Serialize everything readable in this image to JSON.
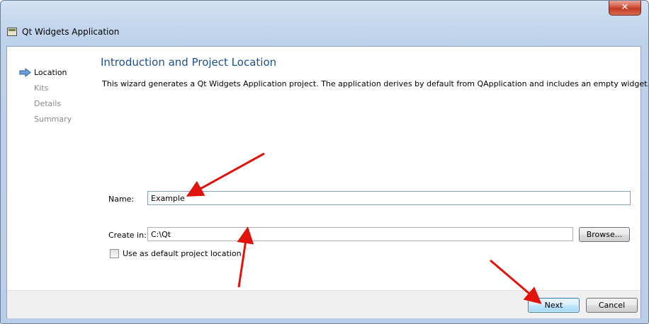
{
  "window": {
    "title": "Qt Widgets Application",
    "close_label": "✕"
  },
  "steps": [
    {
      "label": "Location",
      "active": true
    },
    {
      "label": "Kits",
      "active": false
    },
    {
      "label": "Details",
      "active": false
    },
    {
      "label": "Summary",
      "active": false
    }
  ],
  "page": {
    "heading": "Introduction and Project Location",
    "description": "This wizard generates a Qt Widgets Application project. The application derives by default from QApplication and includes an empty widget."
  },
  "form": {
    "name_label": "Name:",
    "name_value": "Example",
    "create_in_label": "Create in:",
    "create_in_value": "C:\\Qt",
    "browse_label": "Browse...",
    "default_location_label": "Use as default project location",
    "default_location_checked": false
  },
  "buttons": {
    "next": "Next",
    "cancel": "Cancel"
  },
  "colors": {
    "heading": "#1f4e8c",
    "annotation_arrow": "#e0140c"
  }
}
